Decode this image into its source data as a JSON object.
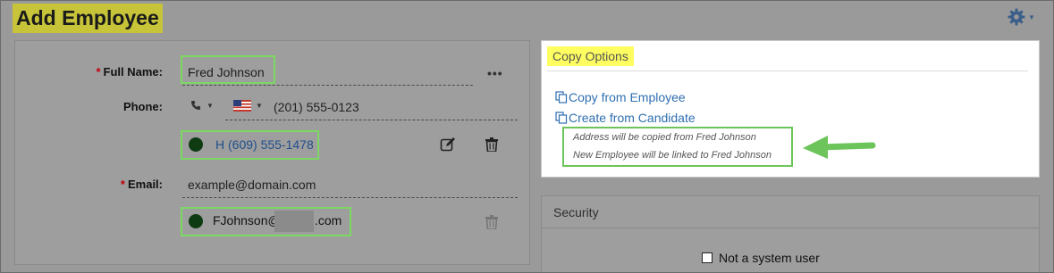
{
  "header": {
    "title": "Add Employee",
    "settings_icon": "gear-icon"
  },
  "form": {
    "full_name": {
      "label": "Full Name:",
      "value": "Fred Johnson",
      "more_label": "•••"
    },
    "phone": {
      "label": "Phone:",
      "type_icon": "phone-icon",
      "country_icon": "us-flag-icon",
      "placeholder": "(201) 555-0123",
      "saved": {
        "status_color": "#0f3b12",
        "text": "H (609) 555-1478"
      }
    },
    "email": {
      "label": "Email:",
      "placeholder": "example@domain.com",
      "saved": {
        "status_color": "#0f3b12",
        "text_start": "FJohnson@",
        "text_end": ".com"
      }
    },
    "required_marker": "*"
  },
  "copy_options": {
    "title": "Copy Options",
    "links": [
      "Copy from Employee",
      "Create from Candidate"
    ],
    "notes": [
      "Address will be copied from Fred Johnson",
      "New Employee will be linked to Fred Johnson"
    ]
  },
  "security": {
    "title": "Security",
    "checkbox_label": "Not a system user",
    "checked": false
  },
  "colors": {
    "highlight_yellow": "#fffe61",
    "annotation_green": "#6cc45a",
    "link_blue": "#2f6fb0"
  }
}
